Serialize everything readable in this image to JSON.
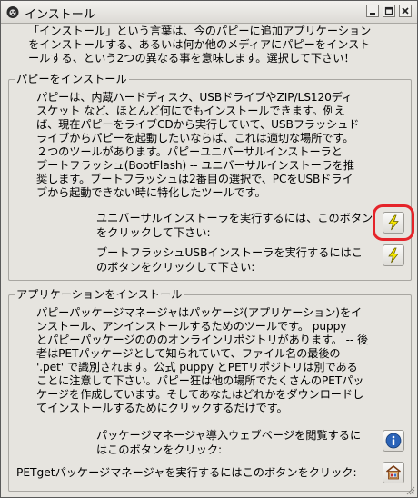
{
  "window": {
    "title": "インストール",
    "icons": {
      "app": "puppy-icon",
      "minimize": "minimize-icon",
      "maximize": "maximize-icon",
      "close": "close-icon"
    }
  },
  "intro": {
    "lines": [
      "「インストール」という言葉は、今のパピーに追加アプリケーション",
      "をインストールする、あるいは何か他のメディアにパピーをインスト",
      "ールする、という2つの異なる事を意味します。選択して下さい！"
    ]
  },
  "puppy_install": {
    "heading": "パピーをインストール",
    "description_lines": [
      "パピーは、内蔵ハードディスク、USBドライブやZIP/LS120ディ",
      "スケット など、ほとんど何にでもインストールできます。例え",
      "ば、現在パピーをライブCDから実行していて、USBフラッシュド",
      "ライブからパピーを起動したいならば、これは適切な場所です。",
      "２つのツールがあります。パピーユニバーサルインストーラと",
      "ブートフラッシュ(BootFlash) -- ユニバーサルインストーラを推",
      "奨します。ブートフラッシュは2番目の選択で、PCをUSBドライ",
      "ブから起動できない時に特化したツールです。"
    ],
    "universal": {
      "lines": [
        "ユニバーサルインストーラを実行するには、このボタン",
        "をクリックして下さい:"
      ],
      "icon": "lightning-icon"
    },
    "bootflash": {
      "lines": [
        "ブートフラッシュUSBインストーラを実行するにはこ",
        "のボタンをクリックして下さい:"
      ],
      "icon": "lightning-icon"
    }
  },
  "app_install": {
    "heading": "アプリケーションをインストール",
    "description_lines": [
      "パピーパッケージマネージャはパッケージ(アプリケーション)をイ",
      "ンストール、アンインストールするためのツールです。  puppy",
      "とパピーパッケージのののオンラインリポジトリがあります。 -- 後",
      "者はPETパッケージとして知られていて、ファイル名の最後の",
      "'.pet' で識別されます。公式 puppy とPETリポジトリは別である",
      "ことに注意して下さい。パピー狂は他の場所でたくさんのPETパッ",
      "ケージを作成しています。そしてあなたはどれかをダウンロードし",
      "てインストールするためにクリックするだけです。"
    ],
    "webpage": {
      "lines": [
        "パッケージマネージャ導入ウェブページを閲覧するに",
        "はこのボタンをクリック:"
      ],
      "icon": "info-icon"
    },
    "petget": {
      "text": "PETgetパッケージマネージャを実行するにはこのボタンをクリック:",
      "icon": "package-icon"
    }
  },
  "colors": {
    "highlight": "#e5242a",
    "lightning": "#f5e600",
    "info": "#2a63b8"
  }
}
